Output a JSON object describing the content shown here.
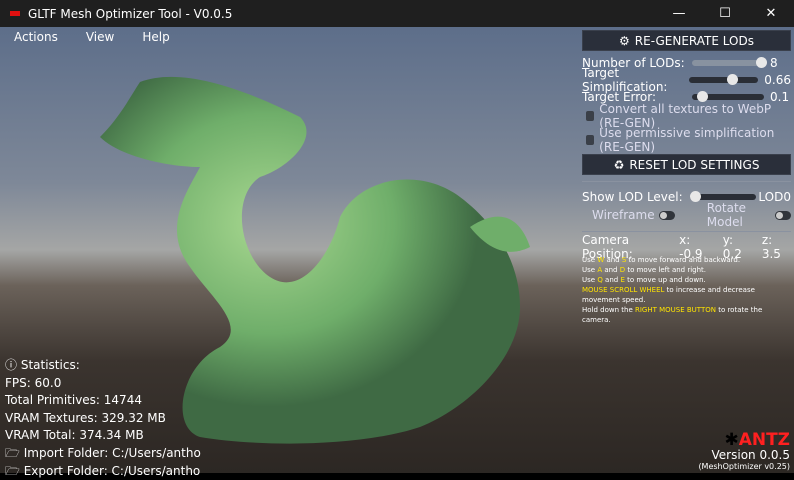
{
  "window": {
    "title": "GLTF Mesh Optimizer Tool - V0.0.5",
    "minimize": "—",
    "maximize": "☐",
    "close": "✕"
  },
  "menu": [
    "Actions",
    "View",
    "Help"
  ],
  "panel": {
    "regenerate_label": "RE-GENERATE LODs",
    "sliders": [
      {
        "label": "Number of LODs:",
        "value": "8",
        "fraction": 0.95
      },
      {
        "label": "Target Simplification:",
        "value": "0.66",
        "fraction": 0.6
      },
      {
        "label": "Target Error:",
        "value": "0.1",
        "fraction": 0.1
      }
    ],
    "checkboxes": [
      {
        "label": "Convert all textures to WebP (RE-GEN)",
        "checked": false
      },
      {
        "label": "Use permissive simplification (RE-GEN)",
        "checked": false
      }
    ],
    "reset_label": "RESET LOD SETTINGS",
    "lod_label": "Show LOD Level:",
    "lod_value": "LOD0",
    "wireframe_label": "Wireframe",
    "rotate_label": "Rotate Model",
    "camera": {
      "label": "Camera Position:",
      "x": "x: -0.9",
      "y": "y: 0.2",
      "z": "z: 3.5"
    },
    "help": [
      [
        "Use ",
        "W",
        " and ",
        "S",
        " to move forward and backward."
      ],
      [
        "Use ",
        "A",
        " and ",
        "D",
        " to move left and right."
      ],
      [
        "Use ",
        "Q",
        " and ",
        "E",
        " to move up and down."
      ],
      [
        "",
        "MOUSE SCROLL WHEEL",
        " to increase and decrease movement speed.",
        "",
        ""
      ],
      [
        "Hold down the ",
        "RIGHT MOUSE BUTTON",
        " to rotate the camera.",
        "",
        ""
      ]
    ]
  },
  "stats": {
    "title": "Statistics:",
    "fps": "FPS: 60.0",
    "primitives": "Total Primitives: 14744",
    "vram_textures": "VRAM Textures: 329.32 MB",
    "vram_total": "VRAM Total: 374.34 MB",
    "import": "Import Folder: C:/Users/antho",
    "export": "Export Folder: C:/Users/antho"
  },
  "brand": {
    "logo": "ANTZ",
    "version": "Version 0.0.5",
    "sub": "(MeshOptimizer v0.25)"
  }
}
